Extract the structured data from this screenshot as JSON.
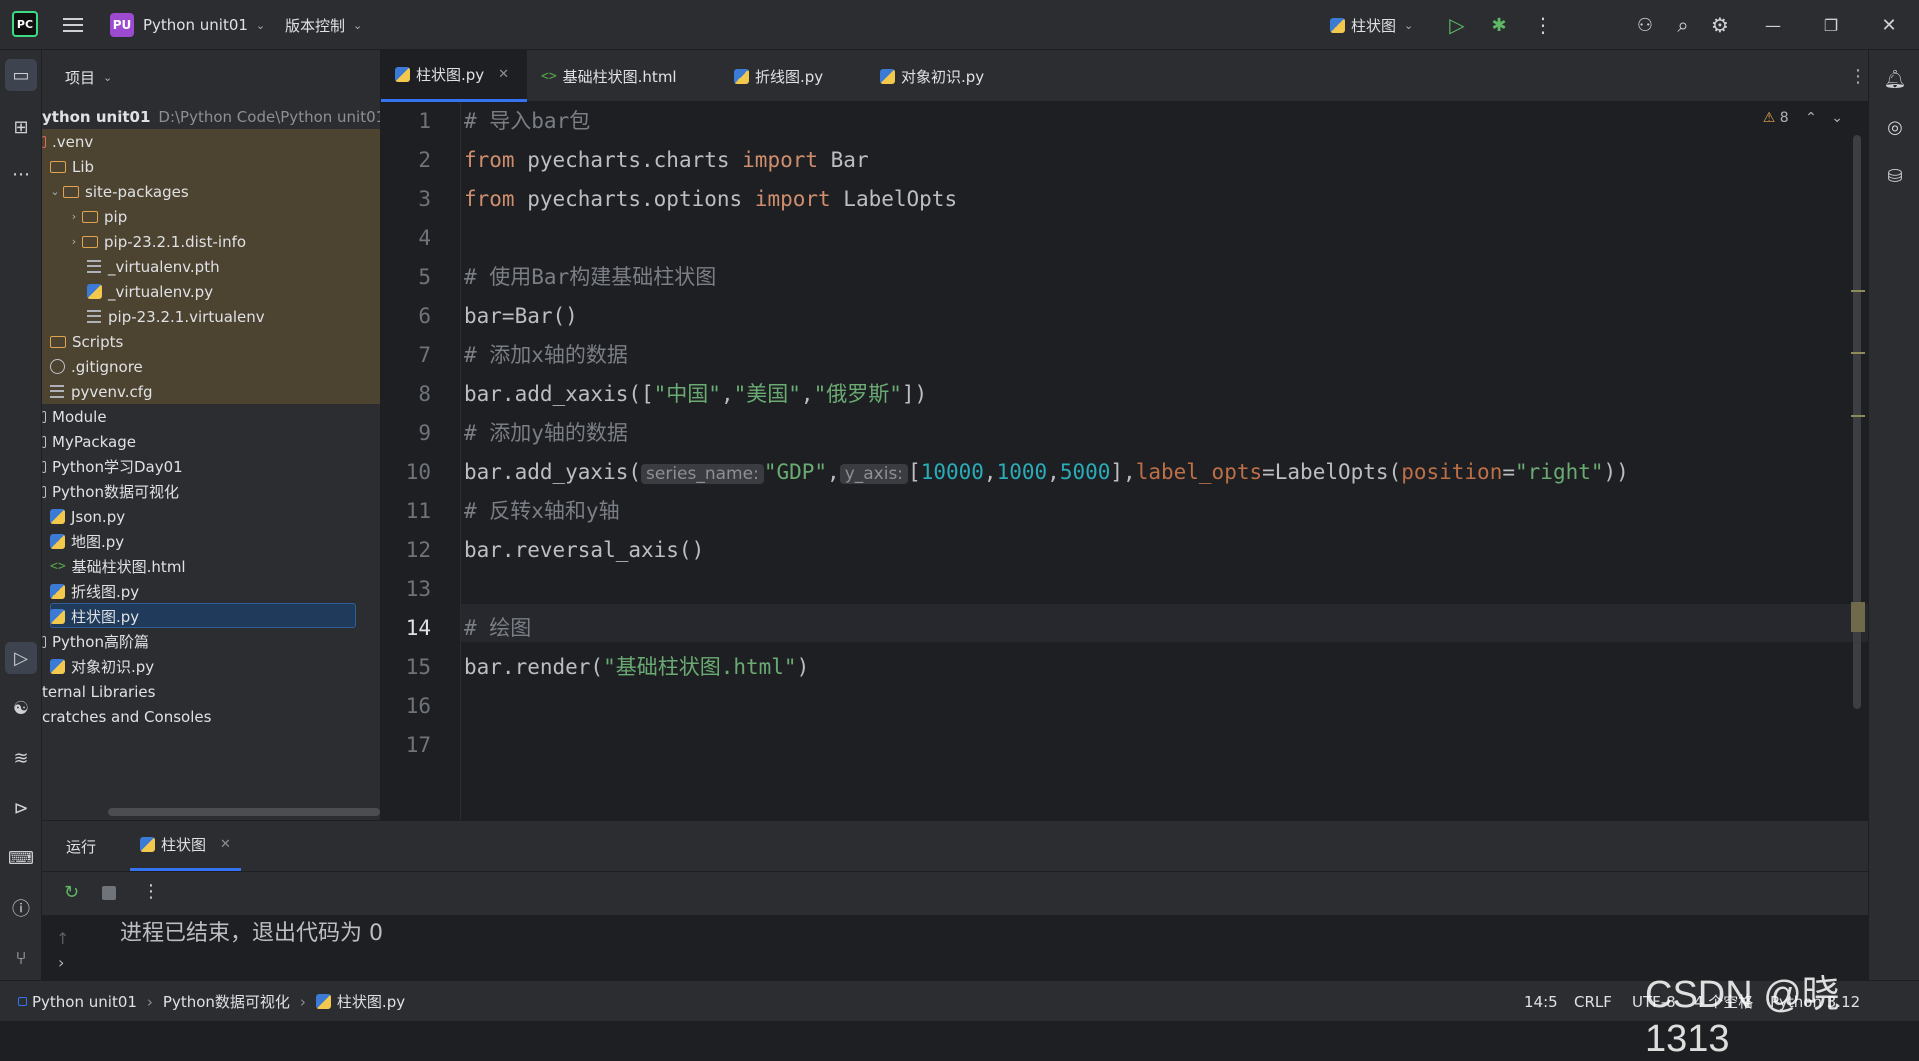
{
  "titlebar": {
    "project_badge": "PU",
    "project_name": "Python unit01",
    "vcs_label": "版本控制",
    "run_config": "柱状图"
  },
  "project_panel": {
    "title": "项目",
    "root_name": "ython unit01",
    "root_path": "D:\\Python Code\\Python unit01",
    "items": [
      {
        "label": ".venv"
      },
      {
        "label": "Lib"
      },
      {
        "label": "site-packages"
      },
      {
        "label": "pip"
      },
      {
        "label": "pip-23.2.1.dist-info"
      },
      {
        "label": "_virtualenv.pth"
      },
      {
        "label": "_virtualenv.py"
      },
      {
        "label": "pip-23.2.1.virtualenv"
      },
      {
        "label": "Scripts"
      },
      {
        "label": ".gitignore"
      },
      {
        "label": "pyvenv.cfg"
      },
      {
        "label": "Module"
      },
      {
        "label": "MyPackage"
      },
      {
        "label": "Python学习Day01"
      },
      {
        "label": "Python数据可视化"
      },
      {
        "label": "Json.py"
      },
      {
        "label": "地图.py"
      },
      {
        "label": "基础柱状图.html"
      },
      {
        "label": "折线图.py"
      },
      {
        "label": "柱状图.py"
      },
      {
        "label": "Python高阶篇"
      },
      {
        "label": "对象初识.py"
      },
      {
        "label": "ternal Libraries"
      },
      {
        "label": "cratches and Consoles"
      }
    ]
  },
  "tabs": [
    {
      "label": "柱状图.py"
    },
    {
      "label": "基础柱状图.html"
    },
    {
      "label": "折线图.py"
    },
    {
      "label": "对象初识.py"
    }
  ],
  "editor": {
    "warnings": "8",
    "line_numbers": [
      "1",
      "2",
      "3",
      "4",
      "5",
      "6",
      "7",
      "8",
      "9",
      "10",
      "11",
      "12",
      "13",
      "14",
      "15",
      "16",
      "17"
    ],
    "lines": {
      "l1": "# 导入bar包",
      "l2_kw1": "from",
      "l2_mod": " pyecharts.charts ",
      "l2_kw2": "import",
      "l2_name": " Bar",
      "l3_kw1": "from",
      "l3_mod": " pyecharts.options ",
      "l3_kw2": "import",
      "l3_name": " LabelOpts",
      "l5": "# 使用Bar构建基础柱状图",
      "l6": "bar=Bar()",
      "l7": "# 添加x轴的数据",
      "l8_a": "bar.add_xaxis([",
      "l8_s1": "\"中国\"",
      "l8_c1": ",",
      "l8_s2": "\"美国\"",
      "l8_c2": ",",
      "l8_s3": "\"俄罗斯\"",
      "l8_b": "])",
      "l9": "# 添加y轴的数据",
      "l10_a": "bar.add_yaxis(",
      "l10_hint1": "series_name:",
      "l10_s1": "\"GDP\"",
      "l10_c1": ",",
      "l10_hint2": "y_axis:",
      "l10_b": "[",
      "l10_n1": "10000",
      "l10_c2": ",",
      "l10_n2": "1000",
      "l10_c3": ",",
      "l10_n3": "5000",
      "l10_c": "],",
      "l10_p1": "label_opts",
      "l10_d": "=LabelOpts(",
      "l10_p2": "position",
      "l10_e": "=",
      "l10_s2": "\"right\"",
      "l10_f": "))",
      "l11": "# 反转x轴和y轴",
      "l12": "bar.reversal_axis()",
      "l14": "# 绘图",
      "l15_a": "bar.render(",
      "l15_s": "\"基础柱状图.html\"",
      "l15_b": ")"
    }
  },
  "run_panel": {
    "tab_run": "运行",
    "tab_config": "柱状图",
    "output": "进程已结束，退出代码为 0"
  },
  "statusbar": {
    "crumb1": "Python unit01",
    "crumb2": "Python数据可视化",
    "crumb3": "柱状图.py",
    "position": "14:5",
    "line_sep": "CRLF",
    "encoding": "UTF-8",
    "indent": "4 个空格",
    "interpreter": "Python 3.12"
  },
  "watermark": "CSDN @晓1313"
}
